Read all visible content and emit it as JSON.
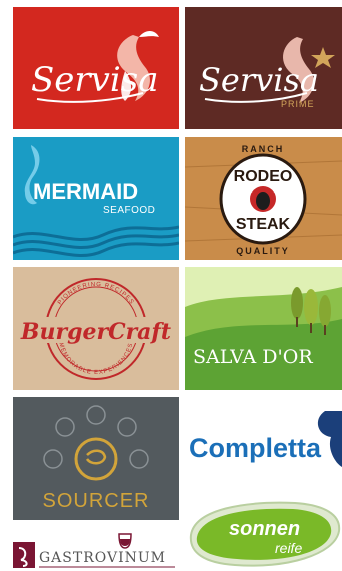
{
  "logos": {
    "servisa": {
      "name": "Servisa",
      "bg": "#d3281f"
    },
    "servisa_prime": {
      "name": "Servisa",
      "tagline": "PRIME",
      "bg": "#5e2a24",
      "accent": "#d2a55a"
    },
    "mermaid": {
      "name": "MERMAID",
      "tagline": "SEAFOOD",
      "bg": "#1a9cc5"
    },
    "rodeo": {
      "top": "RANCH",
      "word1": "RODEO",
      "word2": "STEAK",
      "bottom": "QUALITY",
      "bg": "#c98c4a"
    },
    "burger": {
      "ring_top": "PIONEERING RECIPES",
      "ring_bottom": "MEMORABLE EXPERIENCES",
      "name": "BurgerCraft",
      "bg": "#d9bd9c",
      "color": "#c0282a"
    },
    "salva": {
      "name": "SALVA D'OR",
      "sky": "#cfe6a0",
      "grass": "#5da334"
    },
    "sourcer": {
      "name": "SOURCER",
      "bg": "#535a5e",
      "accent": "#d2a43a"
    },
    "completta": {
      "name": "Completta",
      "color": "#1b6fb8"
    },
    "gastro": {
      "name": "GASTROVINUM",
      "color": "#7a1533"
    },
    "sonnen": {
      "line1": "sonnen",
      "line2": "reife",
      "color": "#7ab928"
    }
  }
}
